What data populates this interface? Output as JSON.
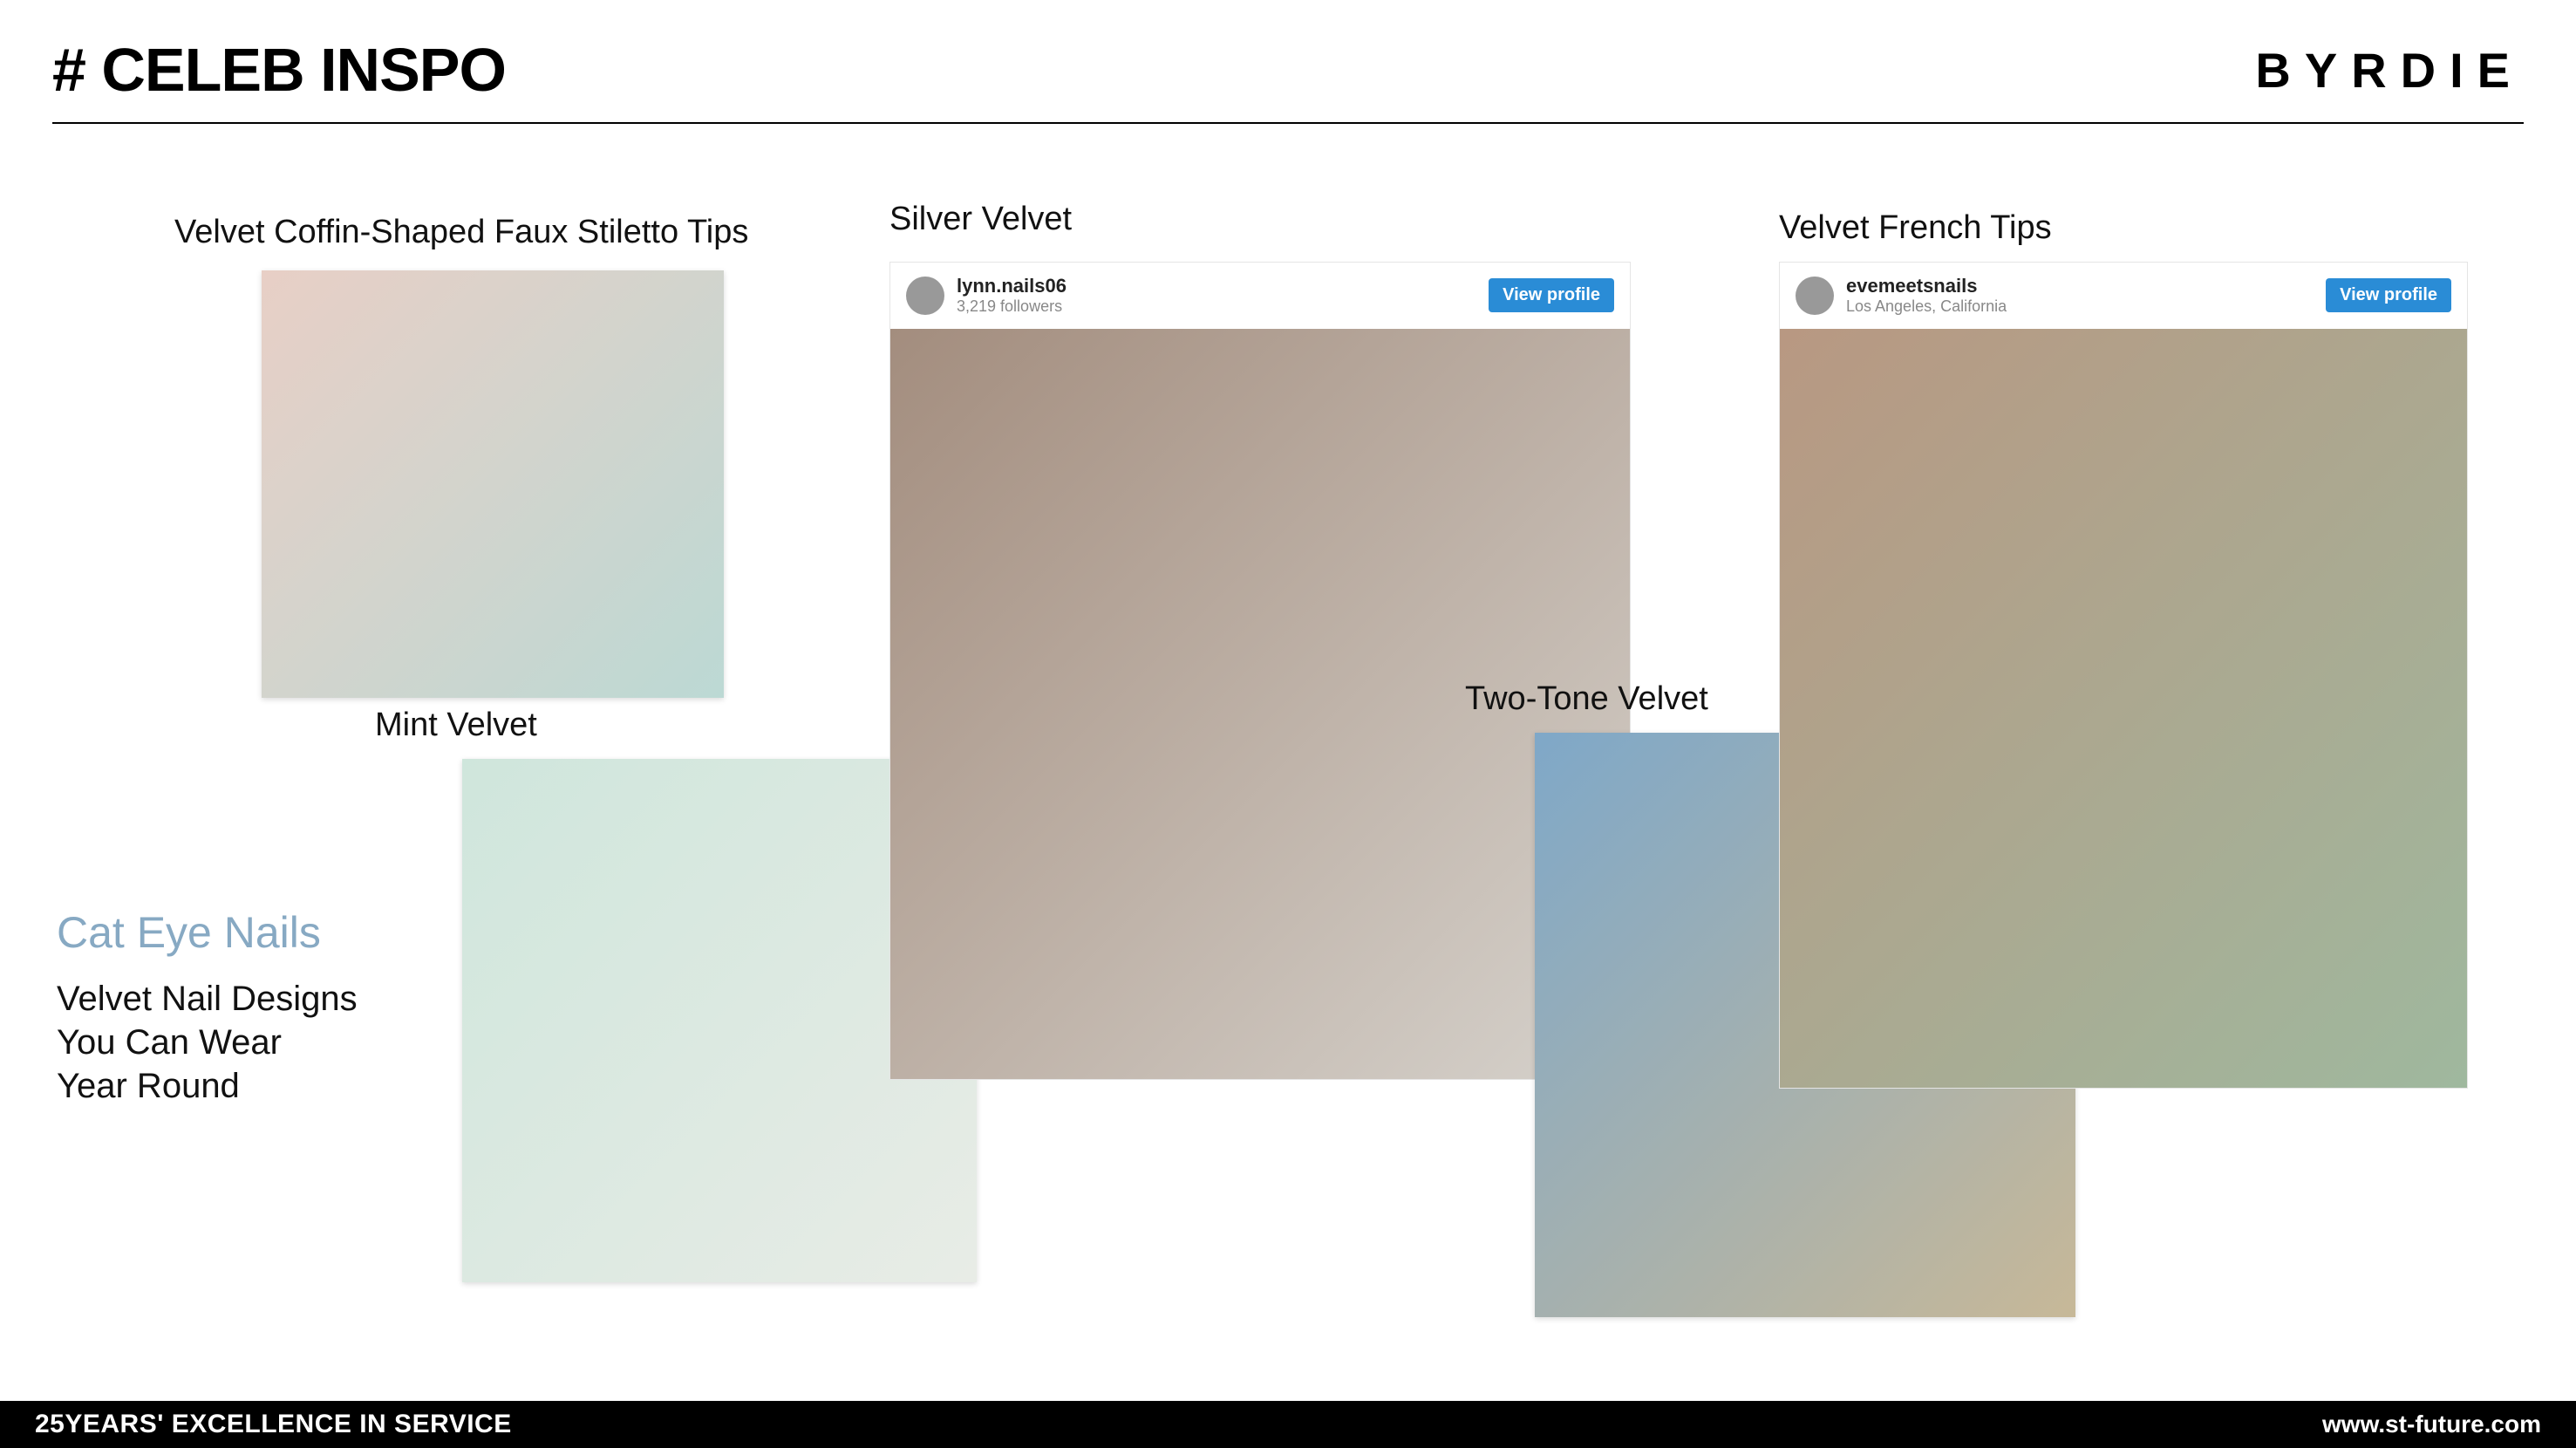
{
  "header": {
    "title": "# CELEB INSPO",
    "brand": "BYRDIE"
  },
  "captions": {
    "coffin": "Velvet Coffin-Shaped Faux Stiletto Tips",
    "mint": "Mint Velvet",
    "silver": "Silver Velvet",
    "twotone": "Two-Tone Velvet",
    "french": "Velvet French Tips"
  },
  "side": {
    "title": "Cat Eye Nails",
    "subtitle": "Velvet Nail Designs\nYou Can Wear\nYear Round"
  },
  "ig": {
    "a": {
      "user": "lynn.nails06",
      "sub": "3,219 followers",
      "btn": "View profile"
    },
    "b": {
      "user": "evemeetsnails",
      "sub": "Los Angeles, California",
      "btn": "View profile"
    }
  },
  "footer": {
    "left": "25YEARS' EXCELLENCE IN SERVICE",
    "right": "www.st-future.com"
  }
}
